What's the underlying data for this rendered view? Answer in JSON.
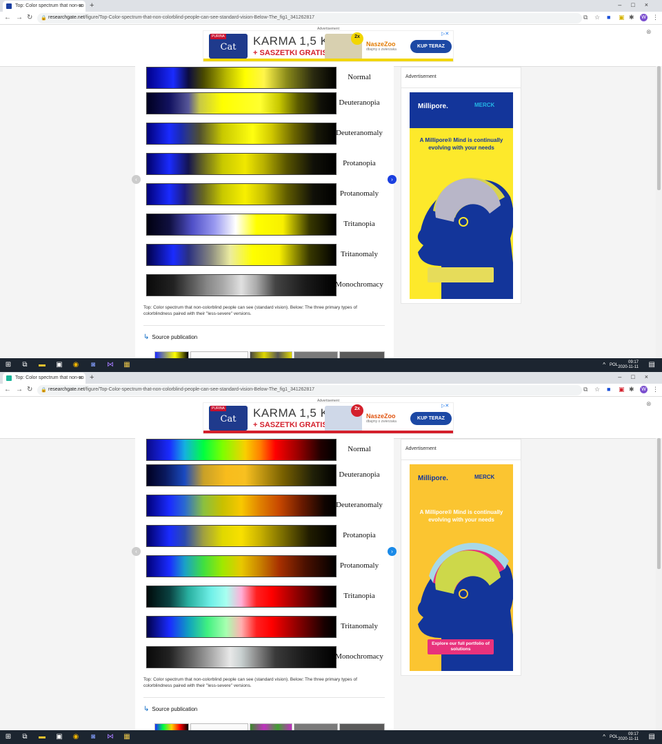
{
  "browser": {
    "tab_title": "Top: Color spectrum that non-co",
    "new_tab": "+",
    "window_controls": "–□×",
    "url_domain": "researchgate.net",
    "url_path": "/figure/Top-Color-spectrum-that-non-colorblind-people-can-see-standard-vision-Below-The_fig1_341262817",
    "profile_initial": "W"
  },
  "banner_ad": {
    "label": "Advertisement",
    "brand_top": "PURINA",
    "brand": "Cat",
    "line1": "KARMA 1,5 KG",
    "line2": "+ SASZETKI GRATIS",
    "badge_top": "2x",
    "badge_bottom": "GRATIS",
    "shop": "NaszeZoo",
    "shop_sub": "dbajmy o zwierzaka",
    "cta": "KUP TERAZ"
  },
  "figure": {
    "labels": [
      "Normal",
      "Deuteranopia",
      "Deuteranomaly",
      "Protanopia",
      "Protanomaly",
      "Tritanopia",
      "Tritanomaly",
      "Monochromacy"
    ],
    "caption": "Top: Color spectrum that non-colorblind people can see (standard vision). Below: The three primary types of colorblindness paired with their \"less-severe\" versions.",
    "source_publication": "Source publication"
  },
  "side_ad": {
    "label": "Advertisement",
    "logo_left": "Millipore.",
    "logo_right": "MERCK",
    "headline": "A Millipore® Mind is continually evolving with your needs",
    "cta": "Explore our full portfolio of solutions"
  },
  "taskbar": {
    "lang": "POL",
    "time": "09:17",
    "date": "2020-11-11"
  },
  "colors": {
    "accent_blue": "#0a69c4",
    "ad_navy": "#13359a",
    "ad_yellow": "#fde92b",
    "ad_gold": "#fbc531",
    "ad_pink": "#e8327c"
  }
}
